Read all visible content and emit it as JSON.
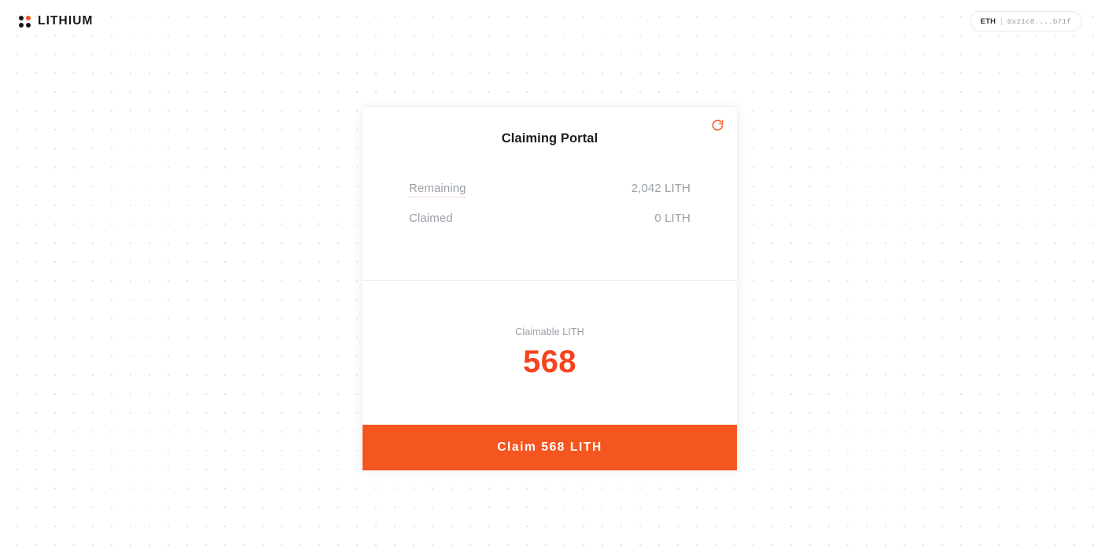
{
  "brand": {
    "name": "LITHIUM",
    "mark_icon": "dots-grid-icon",
    "accent_color": "#f5551e"
  },
  "wallet": {
    "network": "ETH",
    "separator": "|",
    "address": "0x21c8....b71f"
  },
  "card": {
    "title": "Claiming Portal",
    "refresh_icon": "refresh-icon",
    "stats": [
      {
        "label": "Remaining",
        "value": "2,042 LITH",
        "has_tooltip_hint": true
      },
      {
        "label": "Claimed",
        "value": "0 LITH",
        "has_tooltip_hint": false
      }
    ],
    "claimable": {
      "label": "Claimable LITH",
      "amount": "568"
    },
    "claim_button": {
      "label": "Claim 568 LITH",
      "color": "#f5551e"
    }
  }
}
